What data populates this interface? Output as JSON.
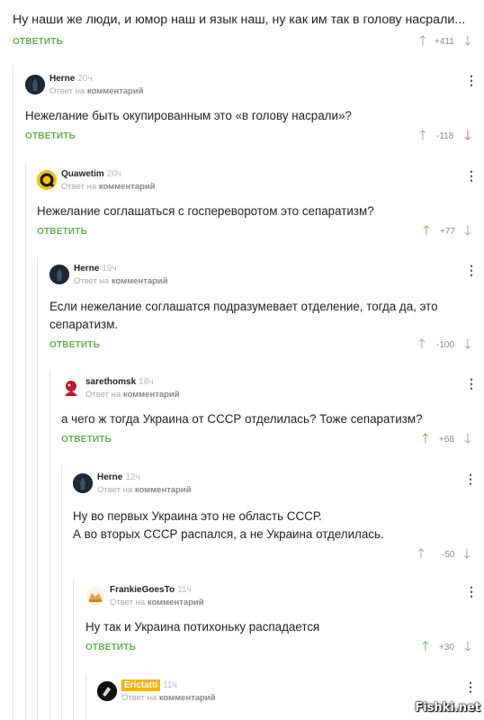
{
  "top": {
    "text": "Ну наши же люди, и юмор наш и язык наш, ну как им так в голову насрали...",
    "reply": "ОТВЕТИТЬ",
    "rating": "+411"
  },
  "reply_to_prefix": "Ответ на",
  "reply_to_link": "комментарий",
  "comments": [
    {
      "user": "Herne",
      "time": "20ч",
      "lines": [
        "Нежелание быть окупированным это «в голову насрали»?"
      ],
      "reply": "ОТВЕТИТЬ",
      "rating": "-118",
      "vote": "down"
    },
    {
      "user": "Quawetim",
      "time": "20ч",
      "lines": [
        "Нежелание соглашаться с госпереворотом это сепаратизм?"
      ],
      "reply": "ОТВЕТИТЬ",
      "rating": "+77",
      "vote": "up"
    },
    {
      "user": "Herne",
      "time": "19ч",
      "lines": [
        "Если нежелание соглашатся подразумевает отделение, тогда да, это",
        "сепаратизм."
      ],
      "reply": "ОТВЕТИТЬ",
      "rating": "-100",
      "vote": "none"
    },
    {
      "user": "sarethomsk",
      "time": "18ч",
      "lines": [
        "а чего ж тогда Украина от СССР отделилась? Тоже сепаратизм?"
      ],
      "reply": "ОТВЕТИТЬ",
      "rating": "+68",
      "vote": "up"
    },
    {
      "user": "Herne",
      "time": "12ч",
      "lines": [
        "Ну во первых Украина это не область СССР.",
        "А во вторых СССР распался, а не Украина отделилась."
      ],
      "reply": "ОТВЕТИТЬ",
      "rating": "-50",
      "vote": "none"
    },
    {
      "user": "FrankieGoesTo",
      "time": "11ч",
      "lines": [
        "Ну так и Украина потихоньку распадается"
      ],
      "reply": "ОТВЕТИТЬ",
      "rating": "+30",
      "vote": "up"
    },
    {
      "user": "Erictatti",
      "time": "11ч",
      "lines": [],
      "reply": "",
      "rating": "",
      "vote": "none"
    }
  ],
  "watermark": "Fishki.net",
  "colors": {
    "green": "#5eb245",
    "red": "#d9534f",
    "gray": "#999999"
  },
  "icons": {
    "upvote": "arrow-up-icon",
    "downvote": "arrow-down-icon",
    "menu": "more-vertical-icon"
  }
}
